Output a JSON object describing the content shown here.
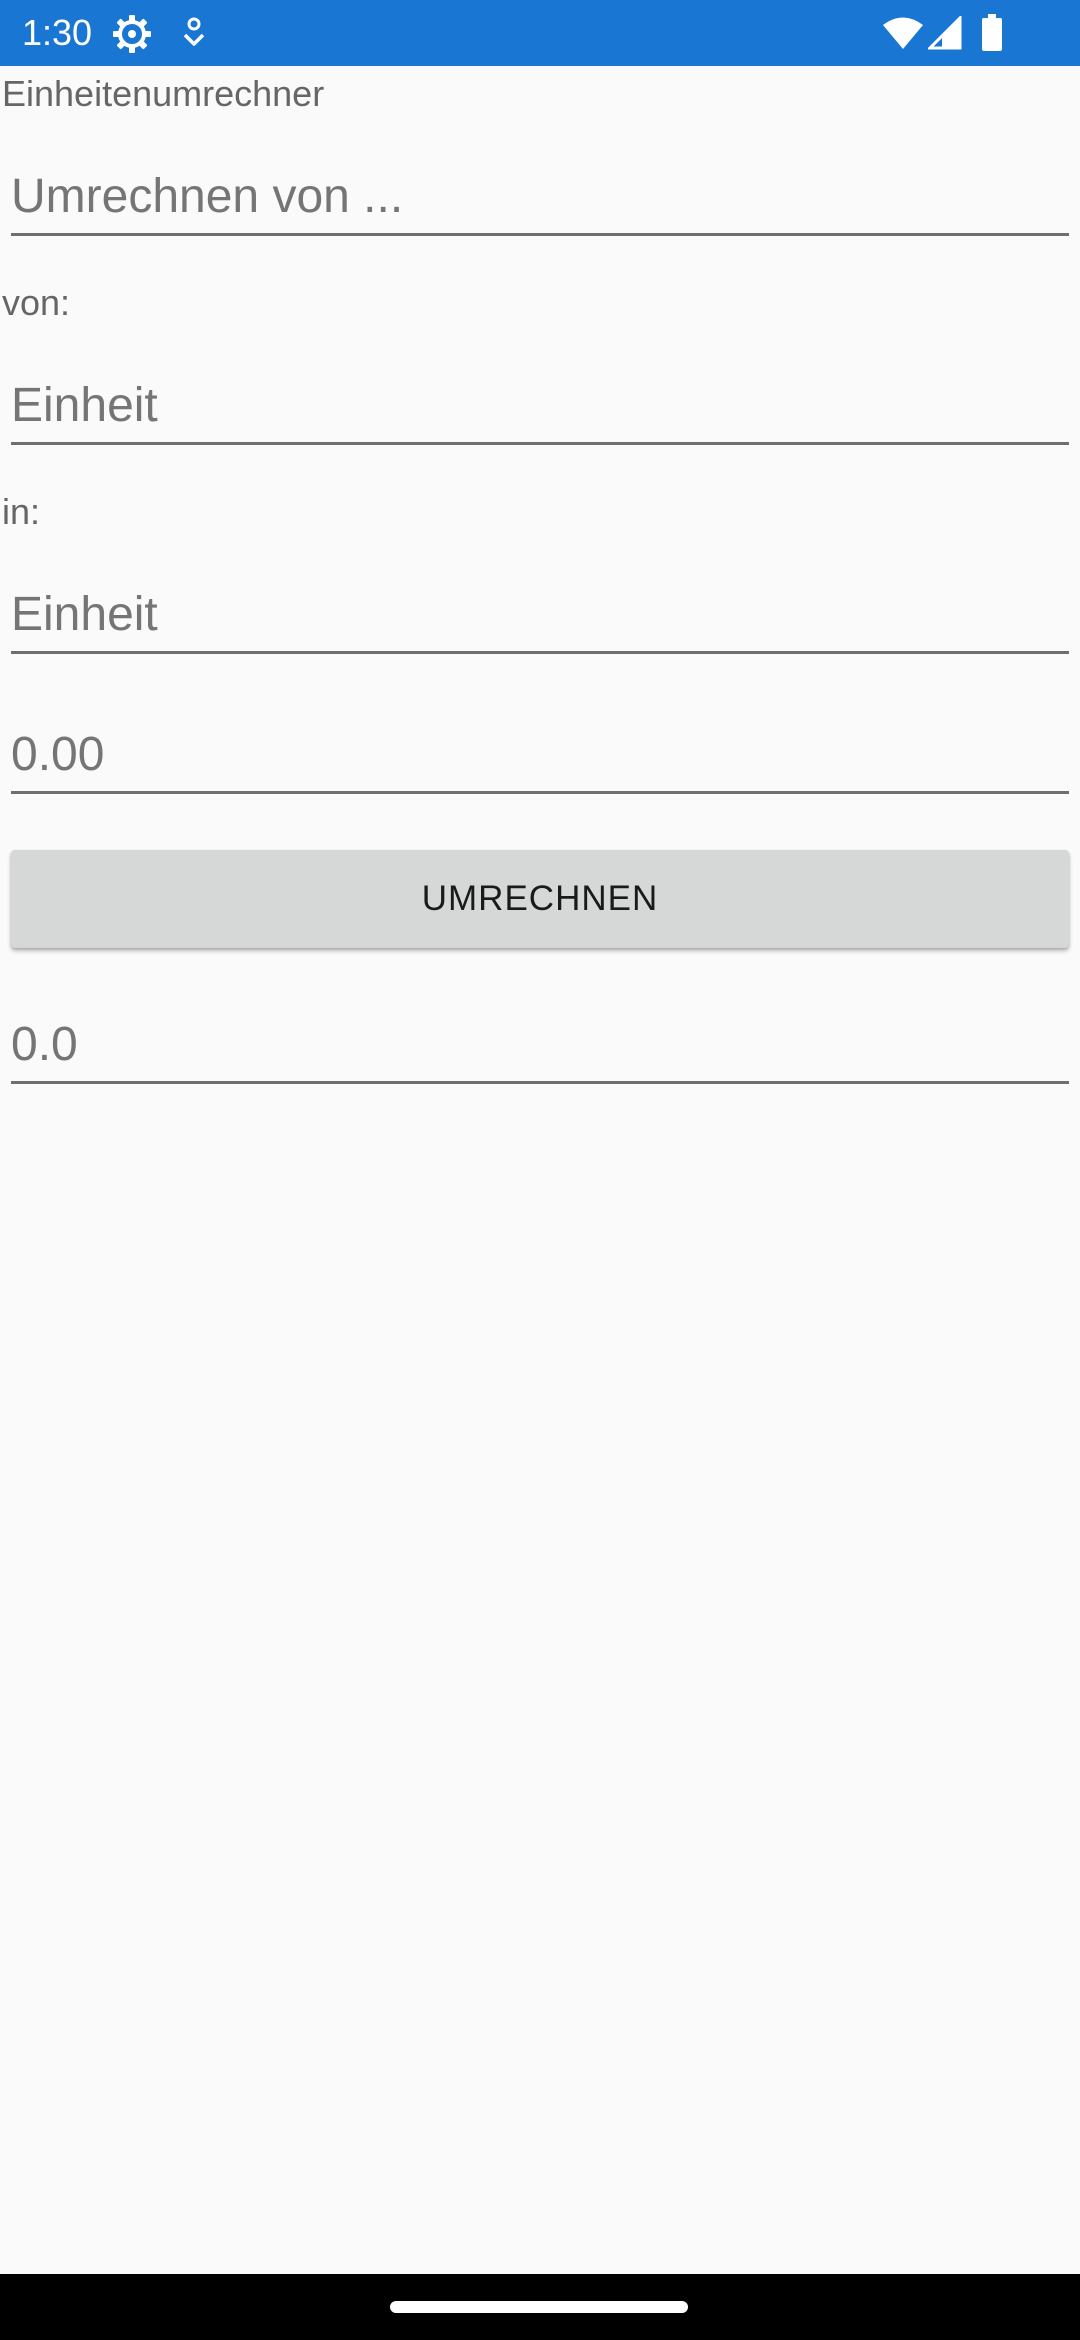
{
  "status_bar": {
    "time": "1:30",
    "color": "#1976d2",
    "icons": [
      "settings-gear-icon",
      "location-download-icon",
      "wifi-icon",
      "cellular-signal-icon",
      "battery-icon"
    ]
  },
  "app": {
    "title": "Einheitenumrechner"
  },
  "form": {
    "source_placeholder": "Umrechnen von ...",
    "from_label": "von:",
    "from_unit_placeholder": "Einheit",
    "to_label": "in:",
    "to_unit_placeholder": "Einheit",
    "amount_placeholder": "0.00",
    "convert_button_label": "UMRECHNEN",
    "result_value": "0.0"
  }
}
